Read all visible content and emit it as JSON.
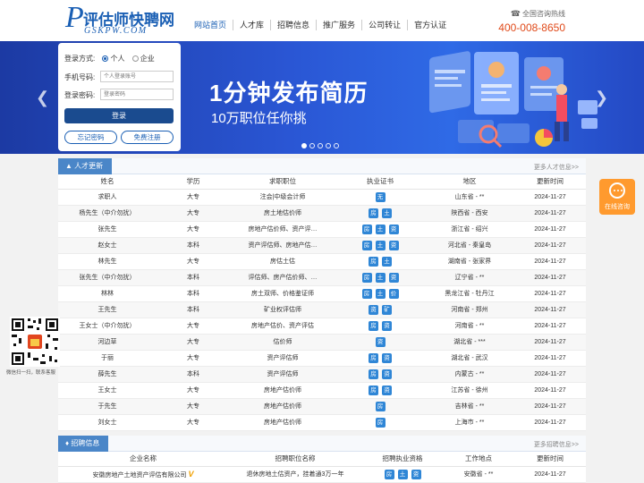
{
  "header": {
    "logo_letter": "P",
    "logo_cn": "评估师快聘网",
    "logo_en": "GSKPW.COM",
    "nav": [
      "网站首页",
      "人才库",
      "招聘信息",
      "推广服务",
      "公司转让",
      "官方认证"
    ],
    "hotline_label": "全国咨询热线",
    "hotline_icon": "phone-icon",
    "phone": "400-008-8650"
  },
  "colors": {
    "brand": "#1a5fb4",
    "accent": "#e04a1a",
    "cert": "#2f86d6",
    "consult": "#ff9a2e"
  },
  "login": {
    "mode_label": "登录方式:",
    "mode_person": "个人",
    "mode_company": "企业",
    "phone_label": "手机号码:",
    "phone_placeholder": "个人登录账号",
    "password_label": "登录密码:",
    "password_placeholder": "登录密码",
    "login_button": "登录",
    "forgot_button": "忘记密码",
    "register_button": "免费注册"
  },
  "banner": {
    "title": "1分钟发布简历",
    "subtitle": "10万职位任你挑",
    "slide_count": 5,
    "active_slide": 1
  },
  "talent": {
    "tab_label": "人才更新",
    "more": "更多人才信息>>",
    "columns": [
      "姓名",
      "学历",
      "求职职位",
      "执业证书",
      "地区",
      "更新时间"
    ],
    "rows": [
      {
        "name": "求职人",
        "edu": "大专",
        "job": "注会|中级会计师",
        "certs": [
          "无"
        ],
        "region": "山东省 - **",
        "date": "2024-11-27"
      },
      {
        "name": "杨先生（中介勿扰）",
        "edu": "大专",
        "job": "房土地估价师",
        "certs": [
          "房",
          "土"
        ],
        "region": "陕西省 - 西安",
        "date": "2024-11-27"
      },
      {
        "name": "张先生",
        "edu": "大专",
        "job": "房地产估价师、资产评…",
        "certs": [
          "房",
          "土",
          "资"
        ],
        "region": "浙江省 - 绍兴",
        "date": "2024-11-27"
      },
      {
        "name": "赵女士",
        "edu": "本科",
        "job": "资产评估师、房地产估…",
        "certs": [
          "房",
          "土",
          "资"
        ],
        "region": "河北省 - 秦皇岛",
        "date": "2024-11-27"
      },
      {
        "name": "林先生",
        "edu": "大专",
        "job": "房估土估",
        "certs": [
          "房",
          "土"
        ],
        "region": "湖南省 - 张家界",
        "date": "2024-11-27"
      },
      {
        "name": "张先生（中介勿扰）",
        "edu": "本科",
        "job": "评估师、房产估价师、…",
        "certs": [
          "房",
          "土",
          "资"
        ],
        "region": "辽宁省 - **",
        "date": "2024-11-27"
      },
      {
        "name": "林林",
        "edu": "本科",
        "job": "房土双师、价格鉴证师",
        "certs": [
          "房",
          "土",
          "价"
        ],
        "region": "黑龙江省 - 牡丹江",
        "date": "2024-11-27"
      },
      {
        "name": "王先生",
        "edu": "本科",
        "job": "矿业权评估师",
        "certs": [
          "资",
          "矿"
        ],
        "region": "河南省 - 郑州",
        "date": "2024-11-27"
      },
      {
        "name": "王女士（中介勿扰）",
        "edu": "大专",
        "job": "房地产估价、资产评估",
        "certs": [
          "房",
          "资"
        ],
        "region": "河南省 - **",
        "date": "2024-11-27"
      },
      {
        "name": "河边草",
        "edu": "大专",
        "job": "估价师",
        "certs": [
          "资"
        ],
        "region": "湖北省 - ***",
        "date": "2024-11-27"
      },
      {
        "name": "于丽",
        "edu": "大专",
        "job": "资产评估师",
        "certs": [
          "房",
          "资"
        ],
        "region": "湖北省 - 武汉",
        "date": "2024-11-27"
      },
      {
        "name": "薛先生",
        "edu": "本科",
        "job": "资产评估师",
        "certs": [
          "房",
          "资"
        ],
        "region": "内蒙古 - **",
        "date": "2024-11-27"
      },
      {
        "name": "王女士",
        "edu": "大专",
        "job": "房地产估价师",
        "certs": [
          "房",
          "资"
        ],
        "region": "江苏省 - 徐州",
        "date": "2024-11-27"
      },
      {
        "name": "于先生",
        "edu": "大专",
        "job": "房地产估价师",
        "certs": [
          "房"
        ],
        "region": "吉林省 - **",
        "date": "2024-11-27"
      },
      {
        "name": "刘女士",
        "edu": "大专",
        "job": "房地产估价师",
        "certs": [
          "房"
        ],
        "region": "上海市 - **",
        "date": "2024-11-27"
      }
    ]
  },
  "jobs": {
    "tab_label": "招聘信息",
    "more": "更多招聘信息>>",
    "columns": [
      "企业名称",
      "招聘职位名称",
      "招聘执业资格",
      "工作地点",
      "更新时间"
    ],
    "rows": [
      {
        "company": "安徽房地产土地资产评估有限公司",
        "verified": "V",
        "title": "退休房地土估资产，挂着通3万一年",
        "certs": [
          "房",
          "土",
          "资"
        ],
        "place": "安徽省 - **",
        "date": "2024-11-27"
      }
    ]
  },
  "side": {
    "qr_caption": "微信扫一扫，联系客服",
    "consult_label": "在线咨询"
  }
}
